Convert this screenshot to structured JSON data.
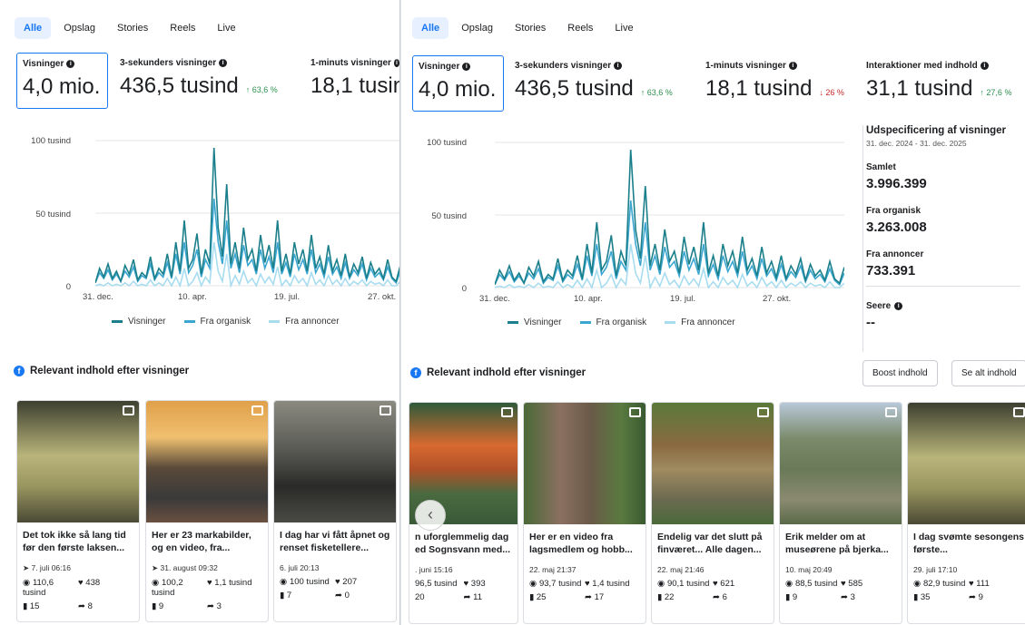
{
  "tabs": [
    "Alle",
    "Opslag",
    "Stories",
    "Reels",
    "Live"
  ],
  "left": {
    "metrics": [
      {
        "label": "Visninger",
        "value": "4,0 mio.",
        "change": "",
        "dir": ""
      },
      {
        "label": "3-sekunders visninger",
        "value": "436,5 tusind",
        "change": "↑ 63,6 %",
        "dir": "up"
      },
      {
        "label": "1-minuts visninger",
        "value": "18,1 tusin",
        "change": "",
        "dir": ""
      }
    ],
    "y_labels": [
      "100 tusind",
      "50 tusind",
      "0"
    ],
    "x_labels": [
      "31. dec.",
      "10. apr.",
      "19. jul.",
      "27. okt."
    ],
    "cards": [
      {
        "title": "Det tok ikke så lang tid før den første laksen...",
        "date": "7. juli 06:16",
        "views": "110,6 tusind",
        "likes": "438",
        "comments": "15",
        "shares": "8"
      },
      {
        "title": "Her er 23 markabilder, og en video, fra...",
        "date": "31. august 09:32",
        "views": "100,2 tusind",
        "likes": "1,1 tusind",
        "comments": "9",
        "shares": "3"
      },
      {
        "title": "I dag har vi fått åpnet og renset fisketellere...",
        "date": "6. juli 20:13",
        "views": "100 tusind",
        "likes": "207",
        "comments": "7",
        "shares": "0"
      }
    ]
  },
  "right": {
    "metrics": [
      {
        "label": "Visninger",
        "value": "4,0 mio.",
        "change": "",
        "dir": ""
      },
      {
        "label": "3-sekunders visninger",
        "value": "436,5 tusind",
        "change": "↑ 63,6 %",
        "dir": "up"
      },
      {
        "label": "1-minuts visninger",
        "value": "18,1 tusind",
        "change": "↓ 26 %",
        "dir": "down"
      },
      {
        "label": "Interaktioner med indhold",
        "value": "31,1 tusind",
        "change": "↑ 27,6 %",
        "dir": "up"
      }
    ],
    "y_labels": [
      "100 tusind",
      "50 tusind",
      "0"
    ],
    "x_labels": [
      "31. dec.",
      "10. apr.",
      "19. jul.",
      "27. okt."
    ],
    "breakdown": {
      "title": "Udspecificering af visninger",
      "daterange": "31. dec. 2024 - 31. dec. 2025",
      "items": [
        {
          "label": "Samlet",
          "value": "3.996.399"
        },
        {
          "label": "Fra organisk",
          "value": "3.263.008"
        },
        {
          "label": "Fra annoncer",
          "value": "733.391"
        }
      ],
      "viewers_label": "Seere",
      "viewers_value": "--"
    },
    "boost": "Boost indhold",
    "see_all": "Se alt indhold",
    "cards": [
      {
        "title": "n uforglemmelig dag ed Sognsvann med...",
        "date": ". juni 15:16",
        "views": "96,5 tusind",
        "likes": "393",
        "comments": "20",
        "shares": "11"
      },
      {
        "title": "Her er en video fra lagsmedlem og hobb...",
        "date": "22. maj 21:37",
        "views": "93,7 tusind",
        "likes": "1,4 tusind",
        "comments": "25",
        "shares": "17"
      },
      {
        "title": "Endelig var det slutt på finværet... Alle dagen...",
        "date": "22. maj 21:46",
        "views": "90,1 tusind",
        "likes": "621",
        "comments": "22",
        "shares": "6"
      },
      {
        "title": "Erik melder om at museørene på bjerka...",
        "date": "10. maj 20:49",
        "views": "88,5 tusind",
        "likes": "585",
        "comments": "9",
        "shares": "3"
      },
      {
        "title": "I dag svømte sesongens første...",
        "date": "29. juli 17:10",
        "views": "82,9 tusind",
        "likes": "111",
        "comments": "35",
        "shares": "9"
      }
    ]
  },
  "legend": [
    "Visninger",
    "Fra organisk",
    "Fra annoncer"
  ],
  "section_title": "Relevant indhold efter visninger",
  "colors": {
    "visninger": "#1a7f8a",
    "organisk": "#3ba6d0",
    "annoncer": "#a8dcef",
    "accent": "#1877f2"
  },
  "chart_data": {
    "type": "line",
    "title": "",
    "ylim": [
      0,
      100000
    ],
    "x_ticks": [
      "31. dec.",
      "10. apr.",
      "19. jul.",
      "27. okt."
    ],
    "series": [
      {
        "name": "Visninger",
        "values": [
          2000,
          12000,
          6000,
          15000,
          5000,
          10000,
          3000,
          14000,
          8000,
          18000,
          4000,
          9000,
          6000,
          20000,
          5000,
          12000,
          8000,
          22000,
          6000,
          30000,
          10000,
          45000,
          12000,
          18000,
          36000,
          8000,
          25000,
          15000,
          95000,
          40000,
          20000,
          70000,
          15000,
          30000,
          12000,
          40000,
          18000,
          25000,
          10000,
          35000,
          16000,
          28000,
          12000,
          45000,
          10000,
          22000,
          8000,
          30000,
          15000,
          25000,
          10000,
          35000,
          12000,
          20000,
          8000,
          28000,
          10000,
          18000,
          7000,
          22000,
          6000,
          15000,
          9000,
          20000,
          5000,
          16000,
          8000,
          12000,
          5000,
          18000,
          6000,
          3000,
          14000
        ]
      },
      {
        "name": "Fra organisk",
        "values": [
          2000,
          9000,
          5000,
          11000,
          4000,
          8000,
          3000,
          10000,
          6000,
          13000,
          3000,
          7000,
          5000,
          15000,
          4000,
          9000,
          6000,
          16000,
          5000,
          22000,
          8000,
          30000,
          9000,
          14000,
          25000,
          6000,
          18000,
          12000,
          60000,
          30000,
          15000,
          45000,
          12000,
          22000,
          9000,
          28000,
          14000,
          18000,
          8000,
          25000,
          12000,
          20000,
          9000,
          30000,
          8000,
          16000,
          6000,
          22000,
          11000,
          18000,
          8000,
          25000,
          9000,
          15000,
          6000,
          20000,
          8000,
          13000,
          5000,
          16000,
          5000,
          11000,
          7000,
          15000,
          4000,
          12000,
          6000,
          9000,
          4000,
          13000,
          5000,
          2000,
          10000
        ]
      },
      {
        "name": "Fra annoncer",
        "values": [
          0,
          1000,
          0,
          2000,
          0,
          1000,
          0,
          2000,
          0,
          3000,
          0,
          1000,
          0,
          4000,
          0,
          2000,
          0,
          5000,
          0,
          6000,
          0,
          12000,
          0,
          3000,
          9000,
          0,
          6000,
          2000,
          30000,
          10000,
          3000,
          22000,
          0,
          7000,
          1000,
          10000,
          2000,
          5000,
          0,
          8000,
          2000,
          6000,
          1000,
          13000,
          0,
          4000,
          0,
          7000,
          2000,
          5000,
          0,
          9000,
          1000,
          4000,
          0,
          7000,
          1000,
          4000,
          0,
          5000,
          0,
          3000,
          1000,
          4000,
          0,
          3000,
          1000,
          2000,
          0,
          4000,
          0,
          0,
          3000
        ]
      }
    ]
  }
}
